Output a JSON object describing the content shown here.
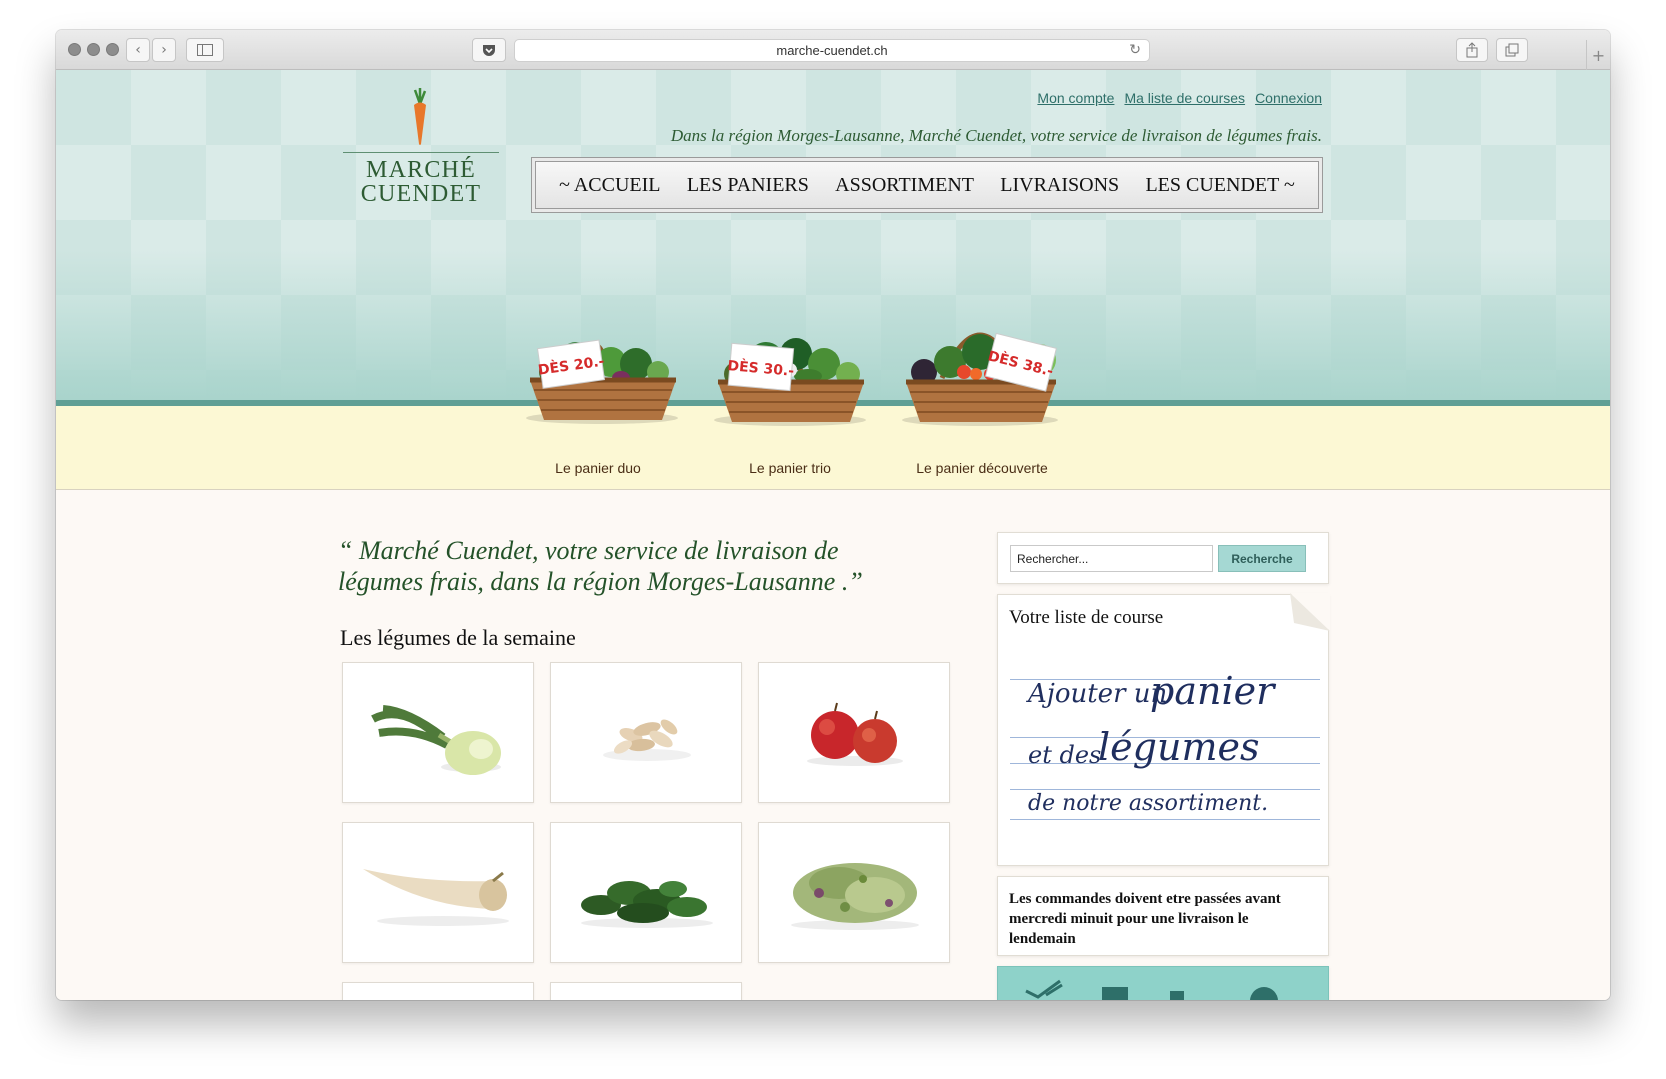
{
  "browser": {
    "url": "marche-cuendet.ch",
    "back_icon": "chevron-left-icon",
    "forward_icon": "chevron-right-icon"
  },
  "site": {
    "logo_line1": "MARCHÉ",
    "logo_line2": "CUENDET",
    "top_links": [
      "Mon compte",
      "Ma liste de courses",
      "Connexion"
    ],
    "tagline": "Dans la région Morges-Lausanne, Marché Cuendet, votre service de livraison de légumes frais.",
    "nav": [
      "~ ACCUEIL",
      "LES PANIERS",
      "ASSORTIMENT",
      "LIVRAISONS",
      "LES CUENDET ~"
    ]
  },
  "baskets": [
    {
      "price": "DÈS 20.-",
      "label": "Le panier duo"
    },
    {
      "price": "DÈS 30.-",
      "label": "Le panier trio"
    },
    {
      "price": "DÈS 38.-",
      "label": "Le panier découverte"
    }
  ],
  "main": {
    "quote": "“ Marché Cuendet, votre service de livraison de légumes frais, dans la région Morges-Lausanne .”",
    "section_title": "Les légumes de la semaine",
    "vegetables": [
      "kohlrabi",
      "salsify",
      "apples",
      "parsnip",
      "lambs-lettuce",
      "sprouts"
    ]
  },
  "sidebar": {
    "search_placeholder": "Rechercher...",
    "search_button": "Recherche",
    "list_title": "Votre liste de course",
    "note_line1a": "Ajouter un",
    "note_line1b": "panier",
    "note_line2a": "et des",
    "note_line2b": "légumes",
    "note_line3": "de notre assortiment.",
    "notice": "Les commandes doivent etre passées avant mercredi minuit pour une livraison le lendemain"
  },
  "colors": {
    "brand_green": "#2d5b33",
    "teal_accent": "#5f9f95",
    "link_teal": "#2e6f69",
    "cream": "#fcf8d4",
    "search_button": "#a5d8d3"
  }
}
